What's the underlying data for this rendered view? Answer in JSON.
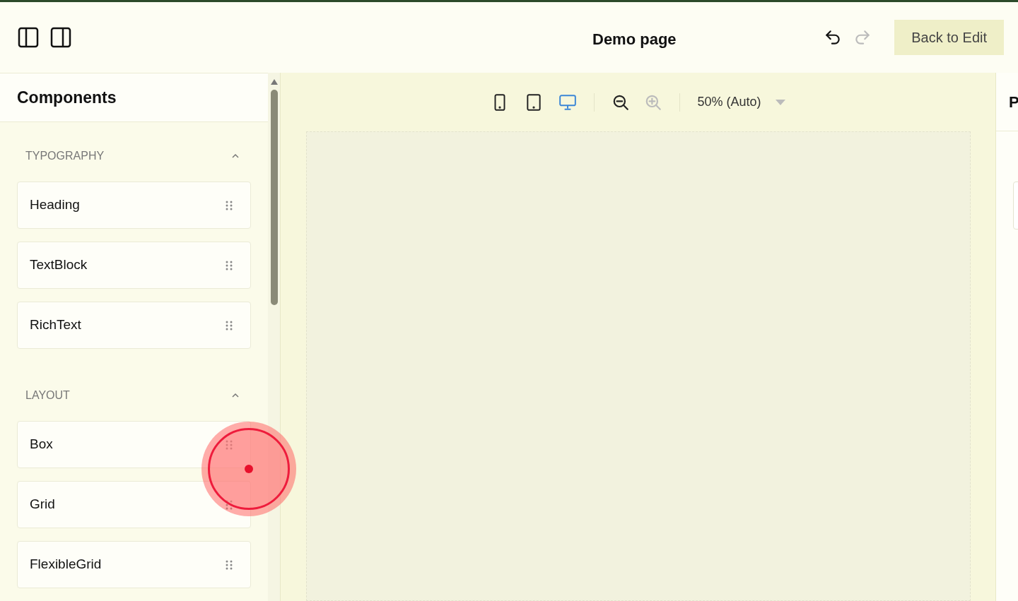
{
  "header": {
    "title": "Demo page",
    "undo": {
      "disabled": false
    },
    "redo": {
      "disabled": true
    },
    "back_button": "Back to Edit"
  },
  "sidebar": {
    "title": "Components",
    "sections": [
      {
        "label": "TYPOGRAPHY",
        "expanded": true,
        "items": [
          "Heading",
          "TextBlock",
          "RichText"
        ]
      },
      {
        "label": "LAYOUT",
        "expanded": true,
        "items": [
          "Box",
          "Grid",
          "FlexibleGrid"
        ]
      }
    ]
  },
  "toolbar": {
    "devices": [
      {
        "kind": "phone",
        "selected": false
      },
      {
        "kind": "tablet",
        "selected": false
      },
      {
        "kind": "desktop",
        "selected": true
      }
    ],
    "zoom_out": {
      "disabled": false
    },
    "zoom_in": {
      "disabled": true
    },
    "zoom_level": "50% (Auto)"
  },
  "right_panel": {
    "title": "P"
  }
}
